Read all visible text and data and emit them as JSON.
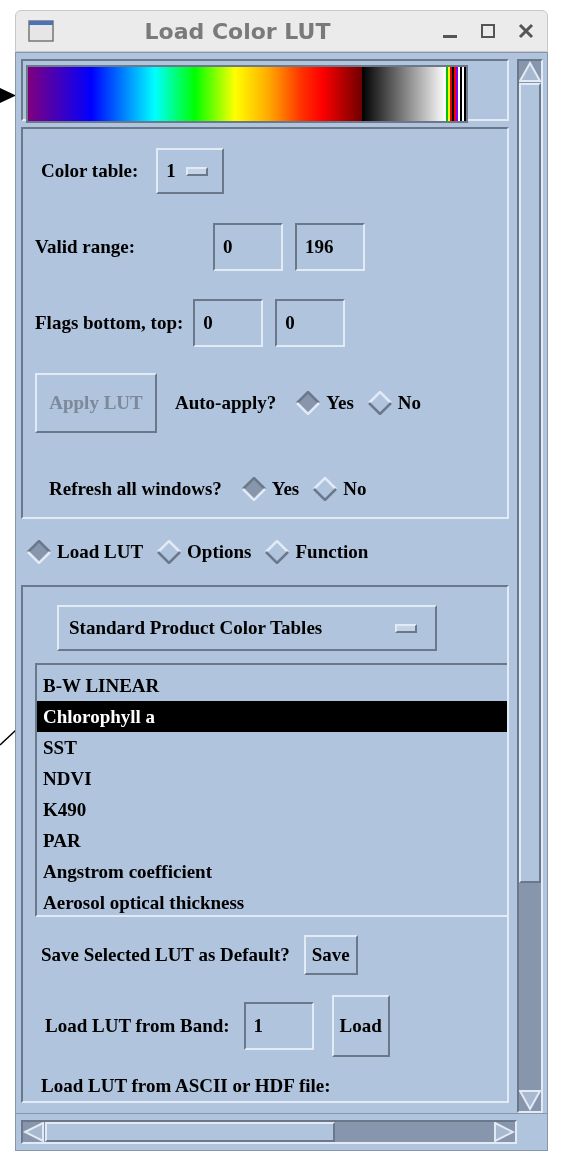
{
  "window": {
    "title": "Load Color LUT"
  },
  "color_table": {
    "label": "Color table:",
    "value": "1"
  },
  "valid_range": {
    "label": "Valid range:",
    "values": [
      "0",
      "196"
    ]
  },
  "flags": {
    "label": "Flags bottom, top:",
    "values": [
      "0",
      "0"
    ]
  },
  "apply_button": {
    "label": "Apply LUT",
    "disabled": true
  },
  "auto_apply": {
    "label": "Auto-apply?",
    "options": [
      {
        "label": "Yes",
        "selected": true
      },
      {
        "label": "No",
        "selected": false
      }
    ]
  },
  "refresh_all": {
    "label": "Refresh all windows?",
    "options": [
      {
        "label": "Yes",
        "selected": true
      },
      {
        "label": "No",
        "selected": false
      }
    ]
  },
  "tabs": [
    {
      "label": "Load LUT",
      "selected": true
    },
    {
      "label": "Options",
      "selected": false
    },
    {
      "label": "Function",
      "selected": false
    }
  ],
  "table_set": {
    "value": "Standard Product Color Tables"
  },
  "lut_list": [
    {
      "label": "B-W LINEAR",
      "selected": false
    },
    {
      "label": "Chlorophyll a",
      "selected": true
    },
    {
      "label": "SST",
      "selected": false
    },
    {
      "label": "NDVI",
      "selected": false
    },
    {
      "label": "K490",
      "selected": false
    },
    {
      "label": "PAR",
      "selected": false
    },
    {
      "label": "Angstrom coefficient",
      "selected": false
    },
    {
      "label": "Aerosol optical thickness",
      "selected": false
    }
  ],
  "save_default": {
    "label": "Save Selected LUT as Default?",
    "button": "Save"
  },
  "load_band": {
    "label": "Load LUT from Band:",
    "value": "1",
    "button": "Load"
  },
  "ascii_label": "Load LUT from ASCII or HDF file:"
}
